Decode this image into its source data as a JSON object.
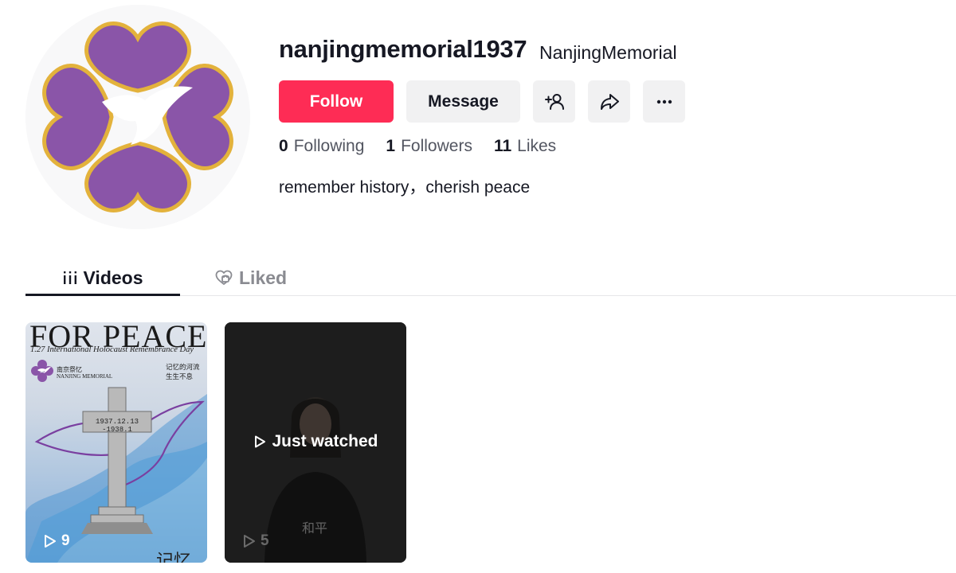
{
  "profile": {
    "username": "nanjingmemorial1937",
    "nickname": "NanjingMemorial",
    "bio": "remember history，cherish peace",
    "avatar_icon": "purple-flower-dove-logo-icon"
  },
  "actions": {
    "follow_label": "Follow",
    "message_label": "Message",
    "add_friend_icon": "add-user-icon",
    "share_icon": "share-icon",
    "more_icon": "more-icon"
  },
  "stats": {
    "following_count": "0",
    "following_label": "Following",
    "followers_count": "1",
    "followers_label": "Followers",
    "likes_count": "11",
    "likes_label": "Likes"
  },
  "tabs": {
    "videos_label": "Videos",
    "liked_label": "Liked",
    "active": "videos"
  },
  "videos": [
    {
      "views": "9",
      "thumb": {
        "title": "FOR PEACE",
        "subtitle": "1.27 International Holocaust Remembrance Day",
        "brand_cn": "南京祭忆",
        "brand_en": "NANJING MEMORIAL",
        "right_line1": "记忆的河流",
        "right_line2": "生生不息",
        "cross_line1": "1937.12.13",
        "cross_line2": "-1938.1",
        "bottom_text": "记忆"
      }
    },
    {
      "views": "5",
      "overlay_label": "Just watched",
      "thumb": {
        "caption_cn": "和平"
      }
    }
  ],
  "colors": {
    "brand_red": "#fe2c55",
    "button_gray": "#f1f1f2",
    "text_primary": "#161823",
    "text_secondary": "#525560",
    "logo_purple": "#8a55a8",
    "logo_gold": "#e3b23c"
  }
}
